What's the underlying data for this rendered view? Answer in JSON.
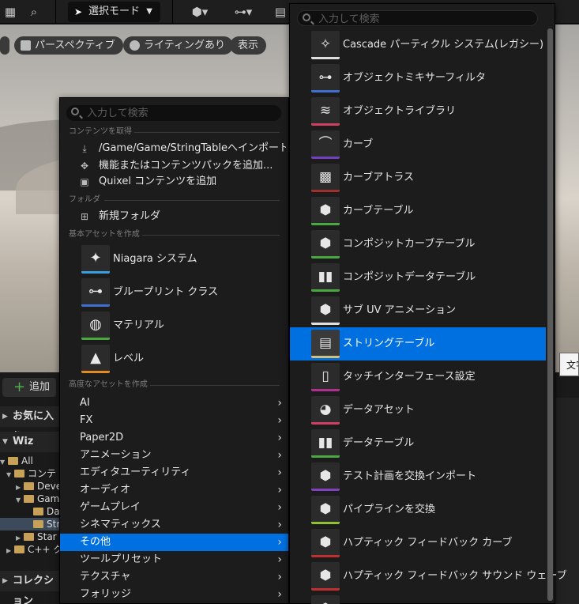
{
  "toolbar": {
    "mode_label": "選択モード",
    "icons": [
      "content-icon",
      "search-marketplace-icon",
      "add-actor-icon",
      "blueprint-icon",
      "cinematics-icon"
    ]
  },
  "viewport": {
    "perspective_label": "パースペクティブ",
    "lighting_label": "ライティングあり",
    "show_label": "表示"
  },
  "content_browser": {
    "add_label": "追加",
    "favorites_label": "お気に入り",
    "project_label": "Wiz",
    "tree": [
      "All",
      "コンテ",
      "Deve",
      "Gam",
      "Da",
      "Str",
      "Star",
      "C++ ク"
    ],
    "collections_label": "コレクション"
  },
  "tooltip": {
    "text": "文字"
  },
  "menu1": {
    "search_placeholder": "入力して検索",
    "sections": {
      "get_content": "コンテンツを取得",
      "folder": "フォルダ",
      "basic": "基本アセットを作成",
      "advanced": "高度なアセットを作成"
    },
    "get_content_items": [
      {
        "label": "/Game/Game/StringTableへインポート..."
      },
      {
        "label": "機能またはコンテンツパックを追加..."
      },
      {
        "label": "Quixel コンテンツを追加"
      }
    ],
    "folder_items": [
      {
        "label": "新規フォルダ"
      }
    ],
    "basic_items": [
      {
        "label": "Niagara システム",
        "color": "#3a9fe0"
      },
      {
        "label": "ブループリント クラス",
        "color": "#3f6fd0"
      },
      {
        "label": "マテリアル",
        "color": "#4aa840"
      },
      {
        "label": "レベル",
        "color": "#e08a20"
      }
    ],
    "advanced_items": [
      {
        "label": "AI"
      },
      {
        "label": "FX"
      },
      {
        "label": "Paper2D"
      },
      {
        "label": "アニメーション"
      },
      {
        "label": "エディタユーティリティ"
      },
      {
        "label": "オーディオ"
      },
      {
        "label": "ゲームプレイ"
      },
      {
        "label": "シネマティックス"
      },
      {
        "label": "その他"
      },
      {
        "label": "ツールプリセット"
      },
      {
        "label": "テクスチャ"
      },
      {
        "label": "フォリッジ"
      }
    ],
    "selected_index": 8
  },
  "menu2": {
    "search_placeholder": "入力して検索",
    "items": [
      {
        "label": "Cascade パーティクル システム(レガシー)",
        "color": "#e0e0e0",
        "icon": "sparkle-icon"
      },
      {
        "label": "オブジェクトミキサーフィルタ",
        "color": "#3f6fd0",
        "icon": "node-graph-icon"
      },
      {
        "label": "オブジェクトライブラリ",
        "color": "#d04060",
        "icon": "stack-icon"
      },
      {
        "label": "カーブ",
        "color": "#7040c0",
        "icon": "curve-icon"
      },
      {
        "label": "カーブアトラス",
        "color": "#a03030",
        "icon": "checker-icon"
      },
      {
        "label": "カーブテーブル",
        "color": "#4aa840",
        "icon": "cube-icon"
      },
      {
        "label": "コンポジットカーブテーブル",
        "color": "#4aa840",
        "icon": "cube-icon"
      },
      {
        "label": "コンポジットデータテーブル",
        "color": "#4aa840",
        "icon": "bar-chart-icon"
      },
      {
        "label": "サブ UV アニメーション",
        "color": "#e0e0e0",
        "icon": "cube-icon"
      },
      {
        "label": "ストリングテーブル",
        "color": "#d0c080",
        "icon": "document-icon"
      },
      {
        "label": "タッチインターフェース設定",
        "color": "#b03090",
        "icon": "tablet-icon"
      },
      {
        "label": "データアセット",
        "color": "#d04060",
        "icon": "pie-chart-icon"
      },
      {
        "label": "データテーブル",
        "color": "#4aa840",
        "icon": "bar-chart-icon"
      },
      {
        "label": "テスト計画を交換インポート",
        "color": "#8040c0",
        "icon": "cube-icon"
      },
      {
        "label": "パイプラインを交換",
        "color": "#90c030",
        "icon": "cube-icon"
      },
      {
        "label": "ハプティック フィードバック カーブ",
        "color": "#c03030",
        "icon": "cube-icon"
      },
      {
        "label": "ハプティック フィードバック サウンド ウェーブ",
        "color": "#c03030",
        "icon": "cube-icon"
      },
      {
        "label": "",
        "color": "#c03030",
        "icon": "cube-icon"
      }
    ],
    "selected_index": 9
  }
}
